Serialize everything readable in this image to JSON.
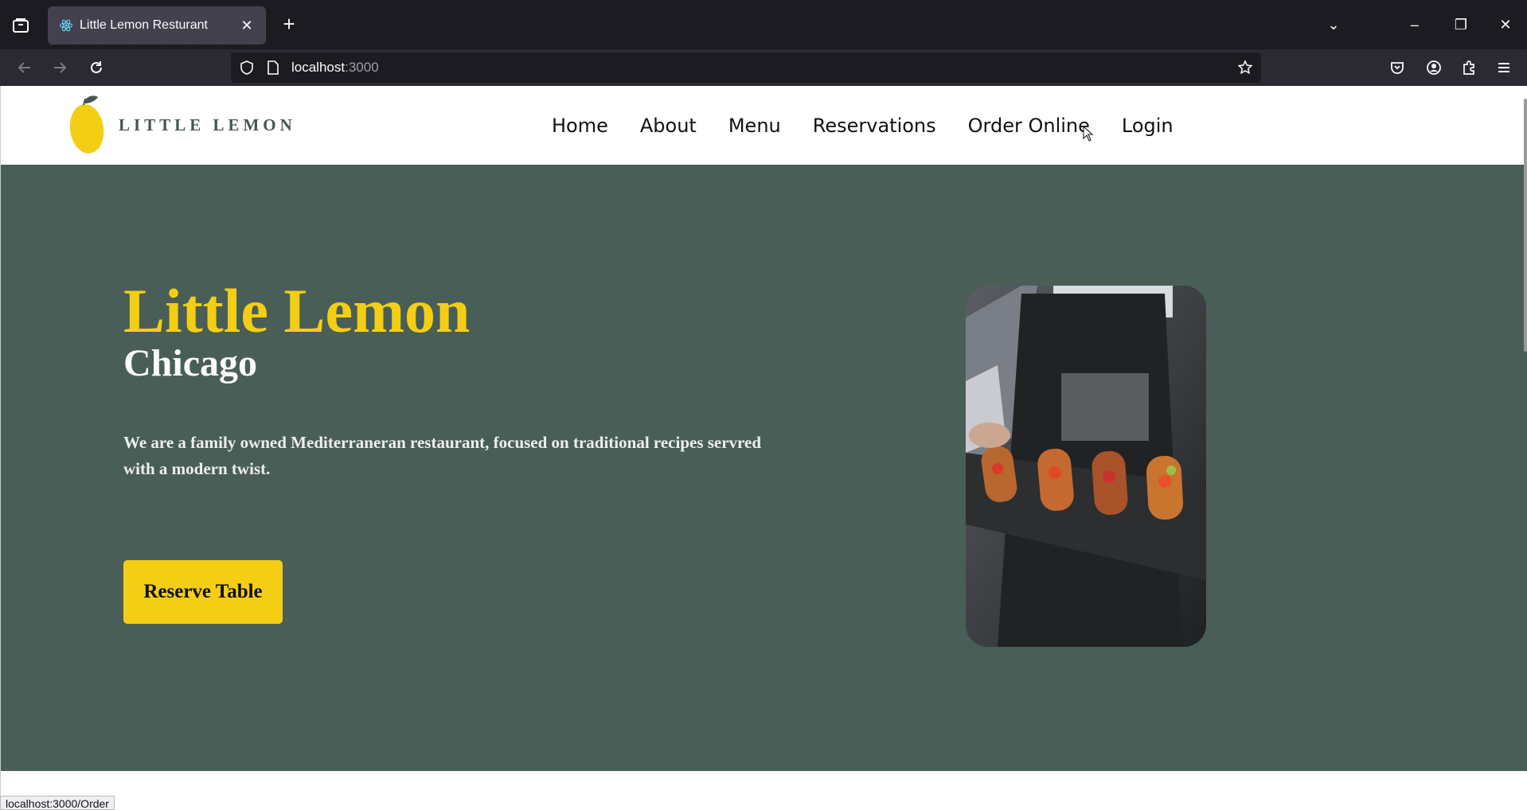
{
  "browser": {
    "tab_title": "Little Lemon Resturant",
    "url_host": "localhost",
    "url_port": ":3000",
    "status_link": "localhost:3000/Order"
  },
  "site": {
    "logo_text": "LITTLE LEMON",
    "nav": [
      "Home",
      "About",
      "Menu",
      "Reservations",
      "Order Online",
      "Login"
    ]
  },
  "hero": {
    "title": "Little Lemon",
    "subtitle": "Chicago",
    "description": "We are a family owned Mediterraneran restaurant, focused on traditional recipes servred with a modern twist.",
    "cta": "Reserve Table"
  },
  "colors": {
    "hero_bg": "#495e57",
    "accent_yellow": "#f4ce14",
    "browser_dark": "#1c1b22"
  },
  "icons": {
    "tab_favicon": "react-atom-icon",
    "back": "arrow-left-icon",
    "forward": "arrow-right-icon",
    "reload": "reload-icon",
    "shield": "shield-icon",
    "page": "page-icon",
    "bookmark": "star-icon",
    "pocket": "pocket-icon",
    "account": "account-icon",
    "extensions": "puzzle-icon",
    "menu": "hamburger-icon"
  }
}
